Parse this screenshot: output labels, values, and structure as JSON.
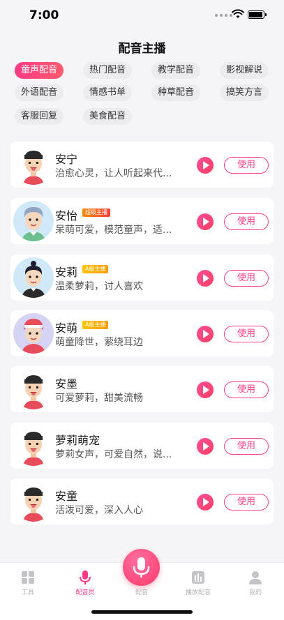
{
  "status_bar": {
    "time": "7:00"
  },
  "page_title": "配音主播",
  "categories": [
    {
      "label": "童声配音",
      "active": true
    },
    {
      "label": "热门配音",
      "active": false
    },
    {
      "label": "教学配音",
      "active": false
    },
    {
      "label": "影视解说",
      "active": false
    },
    {
      "label": "外语配音",
      "active": false
    },
    {
      "label": "情感书单",
      "active": false
    },
    {
      "label": "种草配音",
      "active": false
    },
    {
      "label": "搞笑方言",
      "active": false
    },
    {
      "label": "客服回复",
      "active": false
    },
    {
      "label": "美食配音",
      "active": false
    }
  ],
  "voices": [
    {
      "name": "安宁",
      "badge": "",
      "desc": "治愈心灵，让人听起来代...",
      "use_label": "使用"
    },
    {
      "name": "安怡",
      "badge": "超级主播",
      "desc": "呆萌可爱，模范童声，适...",
      "use_label": "使用"
    },
    {
      "name": "安莉",
      "badge": "A级主播",
      "desc": "温柔萝莉，讨人喜欢",
      "use_label": "使用"
    },
    {
      "name": "安萌",
      "badge": "A级主播",
      "desc": "萌童降世，萦绕耳边",
      "use_label": "使用"
    },
    {
      "name": "安墨",
      "badge": "",
      "desc": "可爱萝莉，甜美流畅",
      "use_label": "使用"
    },
    {
      "name": "萝莉萌宠",
      "badge": "",
      "desc": "萝莉女声，可爱自然，说...",
      "use_label": "使用"
    },
    {
      "name": "安童",
      "badge": "",
      "desc": "活泼可爱，深入人心",
      "use_label": "使用"
    }
  ],
  "tab_bar": {
    "tabs": [
      {
        "label": "工具",
        "icon": "grid-icon",
        "active": false
      },
      {
        "label": "配音员",
        "icon": "mic-icon",
        "active": true
      },
      {
        "label": "配音",
        "icon": "mic-center-icon",
        "active": false
      },
      {
        "label": "播放配音",
        "icon": "equalizer-icon",
        "active": false
      },
      {
        "label": "我的",
        "icon": "user-icon",
        "active": false
      }
    ]
  },
  "colors": {
    "accent": "#ff3a87",
    "badge_super": "#ff3d3d",
    "badge_a": "#ffb000"
  }
}
